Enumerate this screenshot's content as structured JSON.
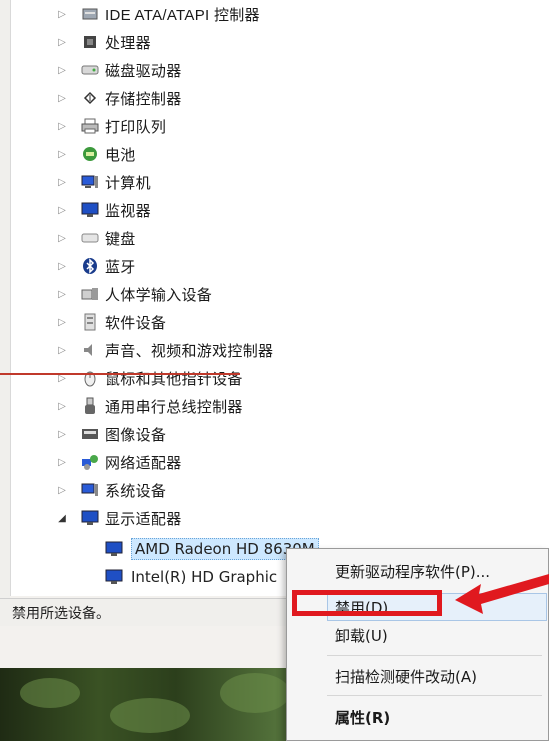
{
  "tree": {
    "categories": [
      {
        "label": "IDE ATA/ATAPI 控制器",
        "icon": "ide-controller-icon"
      },
      {
        "label": "处理器",
        "icon": "processor-icon"
      },
      {
        "label": "磁盘驱动器",
        "icon": "disk-drive-icon"
      },
      {
        "label": "存储控制器",
        "icon": "storage-controller-icon"
      },
      {
        "label": "打印队列",
        "icon": "printer-icon"
      },
      {
        "label": "电池",
        "icon": "battery-icon"
      },
      {
        "label": "计算机",
        "icon": "computer-icon"
      },
      {
        "label": "监视器",
        "icon": "monitor-icon"
      },
      {
        "label": "键盘",
        "icon": "keyboard-icon"
      },
      {
        "label": "蓝牙",
        "icon": "bluetooth-icon"
      },
      {
        "label": "人体学输入设备",
        "icon": "hid-icon"
      },
      {
        "label": "软件设备",
        "icon": "software-device-icon"
      },
      {
        "label": "声音、视频和游戏控制器",
        "icon": "sound-icon"
      },
      {
        "label": "鼠标和其他指针设备",
        "icon": "mouse-icon"
      },
      {
        "label": "通用串行总线控制器",
        "icon": "usb-icon"
      },
      {
        "label": "图像设备",
        "icon": "imaging-device-icon"
      },
      {
        "label": "网络适配器",
        "icon": "network-adapter-icon"
      },
      {
        "label": "系统设备",
        "icon": "system-device-icon"
      },
      {
        "label": "显示适配器",
        "icon": "display-adapter-icon"
      }
    ],
    "children": [
      {
        "label": "AMD Radeon HD 8630M",
        "selected": true
      },
      {
        "label": "Intel(R) HD Graphic",
        "selected": false
      }
    ]
  },
  "status_bar": {
    "text": "禁用所选设备。"
  },
  "context_menu": {
    "items": [
      {
        "label": "更新驱动程序软件(P)...",
        "bold": false
      },
      {
        "label": "禁用(D)",
        "bold": false
      },
      {
        "label": "卸载(U)",
        "bold": false
      },
      {
        "label": "扫描检测硬件改动(A)",
        "bold": false
      },
      {
        "label": "属性(R)",
        "bold": true
      }
    ]
  },
  "colors": {
    "annotation_red": "#e0191f",
    "selection": "#cde8ff"
  }
}
